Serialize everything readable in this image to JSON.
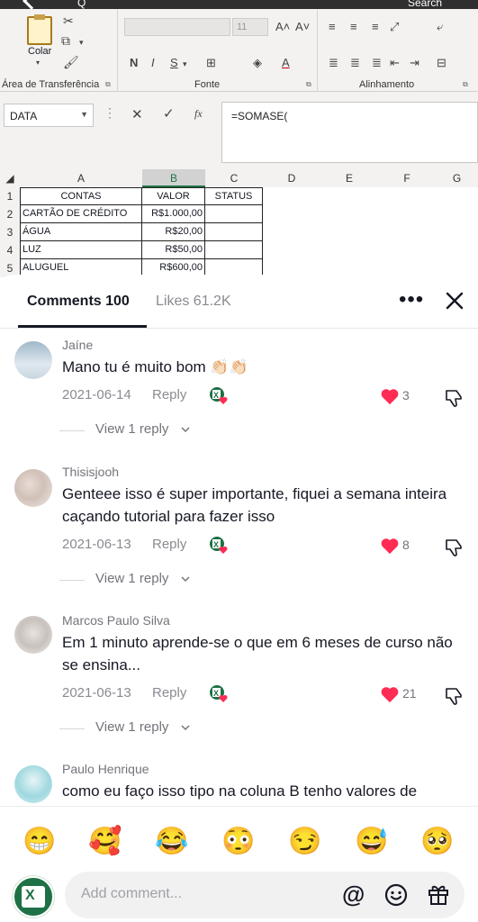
{
  "excel": {
    "top_left_text": "Q",
    "top_right_text": "Search",
    "ribbon": {
      "clipboard": {
        "paste_label": "Colar",
        "group_title": "Área de Transferência"
      },
      "font": {
        "font_size": "11",
        "bold": "N",
        "italic": "I",
        "underline": "S",
        "group_title": "Fonte",
        "grow": "A˄",
        "shrink": "A˅"
      },
      "alignment": {
        "group_title": "Alinhamento"
      }
    },
    "name_box": "DATA",
    "formula": "=SOMASE(",
    "columns": [
      "A",
      "B",
      "C",
      "D",
      "E",
      "F",
      "G"
    ],
    "rows": [
      {
        "num": "1",
        "a": "CONTAS",
        "b": "VALOR",
        "c": "STATUS"
      },
      {
        "num": "2",
        "a": "CARTÃO DE CRÉDITO",
        "b": "R$1.000,00",
        "c": ""
      },
      {
        "num": "3",
        "a": "ÁGUA",
        "b": "R$20,00",
        "c": ""
      },
      {
        "num": "4",
        "a": "LUZ",
        "b": "R$50,00",
        "c": ""
      },
      {
        "num": "5",
        "a": "ALUGUEL",
        "b": "R$600,00",
        "c": ""
      }
    ]
  },
  "tabs": {
    "comments": "Comments 100",
    "likes": "Likes 61.2K"
  },
  "comments": [
    {
      "name": "Jaíne",
      "text": "Mano tu é muito bom 👏🏻👏🏻",
      "date": "2021-06-14",
      "reply": "Reply",
      "likes": "3",
      "view_replies": "View 1 reply"
    },
    {
      "name": "Thisisjooh",
      "text": "Genteee isso é super importante, fiquei a semana inteira caçando tutorial para fazer isso",
      "date": "2021-06-13",
      "reply": "Reply",
      "likes": "8",
      "view_replies": "View 1 reply"
    },
    {
      "name": "Marcos Paulo Silva",
      "text": "Em 1 minuto aprende-se o que em 6 meses de curso não se ensina...",
      "date": "2021-06-13",
      "reply": "Reply",
      "likes": "21",
      "view_replies": "View 1 reply"
    },
    {
      "name": "Paulo Henrique",
      "text": "como eu faço isso tipo na coluna B tenho valores de"
    }
  ],
  "emojis": [
    "😁",
    "🥰",
    "😂",
    "😳",
    "😏",
    "😅",
    "🥺"
  ],
  "input": {
    "placeholder": "Add comment..."
  },
  "colors": {
    "heart": "#fe2c55",
    "excel_green": "#1e7145",
    "text": "#161823",
    "muted": "#8a8b91"
  }
}
